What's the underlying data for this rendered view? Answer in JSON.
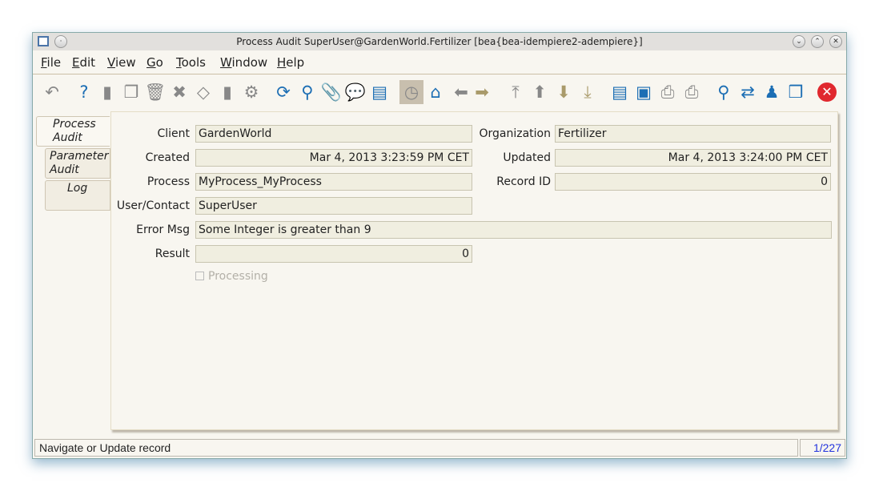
{
  "window": {
    "title": "Process Audit  SuperUser@GardenWorld.Fertilizer [bea{bea-idempiere2-adempiere}]"
  },
  "menu": [
    "File",
    "Edit",
    "View",
    "Go",
    "Tools",
    "Window",
    "Help"
  ],
  "toolbar": [
    {
      "name": "undo",
      "glyph": "↶"
    },
    {
      "name": "help",
      "glyph": "?"
    },
    {
      "name": "new-record",
      "glyph": "▮"
    },
    {
      "name": "copy-record",
      "glyph": "❐"
    },
    {
      "name": "delete",
      "glyph": "🗑"
    },
    {
      "name": "delete-selection",
      "glyph": "✖"
    },
    {
      "name": "save",
      "glyph": "◇"
    },
    {
      "name": "save-and-new",
      "glyph": "▮"
    },
    {
      "name": "settings",
      "glyph": "⚙"
    },
    {
      "name": "refresh",
      "glyph": "⟳"
    },
    {
      "name": "find",
      "glyph": "⚲"
    },
    {
      "name": "attachment",
      "glyph": "📎"
    },
    {
      "name": "chat",
      "glyph": "💬"
    },
    {
      "name": "grid-toggle",
      "glyph": "▤"
    },
    {
      "name": "history",
      "glyph": "◷"
    },
    {
      "name": "home",
      "glyph": "⌂"
    },
    {
      "name": "back",
      "glyph": "⬅"
    },
    {
      "name": "forward",
      "glyph": "➡"
    },
    {
      "name": "first-record",
      "glyph": "⤒"
    },
    {
      "name": "previous-record",
      "glyph": "⬆"
    },
    {
      "name": "next-record",
      "glyph": "⬇"
    },
    {
      "name": "last-record",
      "glyph": "⤓"
    },
    {
      "name": "report",
      "glyph": "▤"
    },
    {
      "name": "archive",
      "glyph": "▣"
    },
    {
      "name": "print-preview",
      "glyph": "⎙"
    },
    {
      "name": "print",
      "glyph": "⎙"
    },
    {
      "name": "zoom-across",
      "glyph": "⚲"
    },
    {
      "name": "workflow",
      "glyph": "⇄"
    },
    {
      "name": "request",
      "glyph": "♟"
    },
    {
      "name": "product-info",
      "glyph": "❒"
    },
    {
      "name": "close",
      "glyph": "✕"
    }
  ],
  "tabs": [
    {
      "line1": "Process",
      "line2": "Audit"
    },
    {
      "line1": "Parameter",
      "line2": "Audit"
    },
    {
      "line1": "Log",
      "line2": ""
    }
  ],
  "form": {
    "client_label": "Client",
    "client": "GardenWorld",
    "org_label": "Organization",
    "org": "Fertilizer",
    "created_label": "Created",
    "created": "Mar 4, 2013 3:23:59 PM CET",
    "updated_label": "Updated",
    "updated": "Mar 4, 2013 3:24:00 PM CET",
    "process_label": "Process",
    "process": "MyProcess_MyProcess",
    "recordid_label": "Record ID",
    "recordid": "0",
    "user_label": "User/Contact",
    "user": "SuperUser",
    "error_label": "Error Msg",
    "error": "Some Integer is greater than 9",
    "result_label": "Result",
    "result": "0",
    "processing_label": "Processing"
  },
  "status": {
    "message": "Navigate or Update record",
    "count": "1/227"
  }
}
